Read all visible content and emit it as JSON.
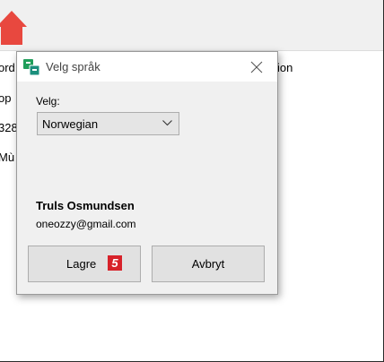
{
  "background": {
    "texts": [
      "ord",
      "op",
      "328",
      "Mù",
      "ion"
    ]
  },
  "dialog": {
    "title": "Velg språk",
    "icon": "language-translate-icon",
    "close_icon": "close-icon",
    "language_label": "Velg:",
    "language_selected": "Norwegian",
    "user_name": "Truls Osmundsen",
    "user_email": "oneozzy@gmail.com",
    "save_label": "Lagre",
    "cancel_label": "Avbryt",
    "step_badge": "5"
  },
  "colors": {
    "home_icon": "#e8483f",
    "badge": "#d7222a",
    "dialog_icon_green": "#1f9e5a",
    "dialog_icon_teal": "#1b8f7c"
  }
}
